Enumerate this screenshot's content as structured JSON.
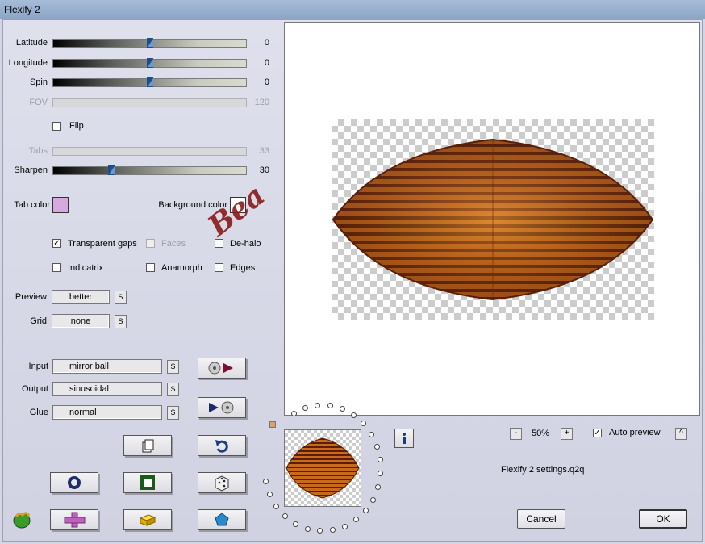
{
  "window": {
    "title": "Flexify 2"
  },
  "sliders": [
    {
      "id": "latitude",
      "label": "Latitude",
      "value": "0",
      "pos": 0.5,
      "enabled": true
    },
    {
      "id": "longitude",
      "label": "Longitude",
      "value": "0",
      "pos": 0.5,
      "enabled": true
    },
    {
      "id": "spin",
      "label": "Spin",
      "value": "0",
      "pos": 0.5,
      "enabled": true
    },
    {
      "id": "fov",
      "label": "FOV",
      "value": "120",
      "pos": 1.0,
      "enabled": false
    },
    {
      "id": "tabs",
      "label": "Tabs",
      "value": "33",
      "pos": 0.33,
      "enabled": false
    },
    {
      "id": "sharpen",
      "label": "Sharpen",
      "value": "30",
      "pos": 0.3,
      "enabled": true
    }
  ],
  "flip": {
    "label": "Flip",
    "checked": false
  },
  "colors": {
    "tab_color_label": "Tab color",
    "tab_color": "#d8a8e0",
    "background_color_label": "Background color",
    "background_color": "#ffffff"
  },
  "options": {
    "transparent_gaps": {
      "label": "Transparent gaps",
      "checked": true
    },
    "faces": {
      "label": "Faces",
      "checked": false
    },
    "dehalo": {
      "label": "De-halo",
      "checked": false
    },
    "indicatrix": {
      "label": "Indicatrix",
      "checked": false
    },
    "anamorph": {
      "label": "Anamorph",
      "checked": false
    },
    "edges": {
      "label": "Edges",
      "checked": false
    }
  },
  "preview_setting": {
    "label": "Preview",
    "value": "better"
  },
  "grid_setting": {
    "label": "Grid",
    "value": "none"
  },
  "input": {
    "label": "Input",
    "value": "mirror ball"
  },
  "output": {
    "label": "Output",
    "value": "sinusoidal"
  },
  "glue": {
    "label": "Glue",
    "value": "normal"
  },
  "spin_btn": "S",
  "zoom": {
    "minus": "-",
    "value": "50%",
    "plus": "+"
  },
  "auto_preview": {
    "label": "Auto preview",
    "checked": true,
    "btn": "^"
  },
  "settings_file": "Flexify 2 settings.q2q",
  "buttons": {
    "cancel": "Cancel",
    "ok": "OK"
  },
  "watermark": "Bea",
  "accent": {
    "thumb": "#1c4f8a",
    "shape_dark": "#5a1e08",
    "shape_light": "#e08a2a"
  }
}
